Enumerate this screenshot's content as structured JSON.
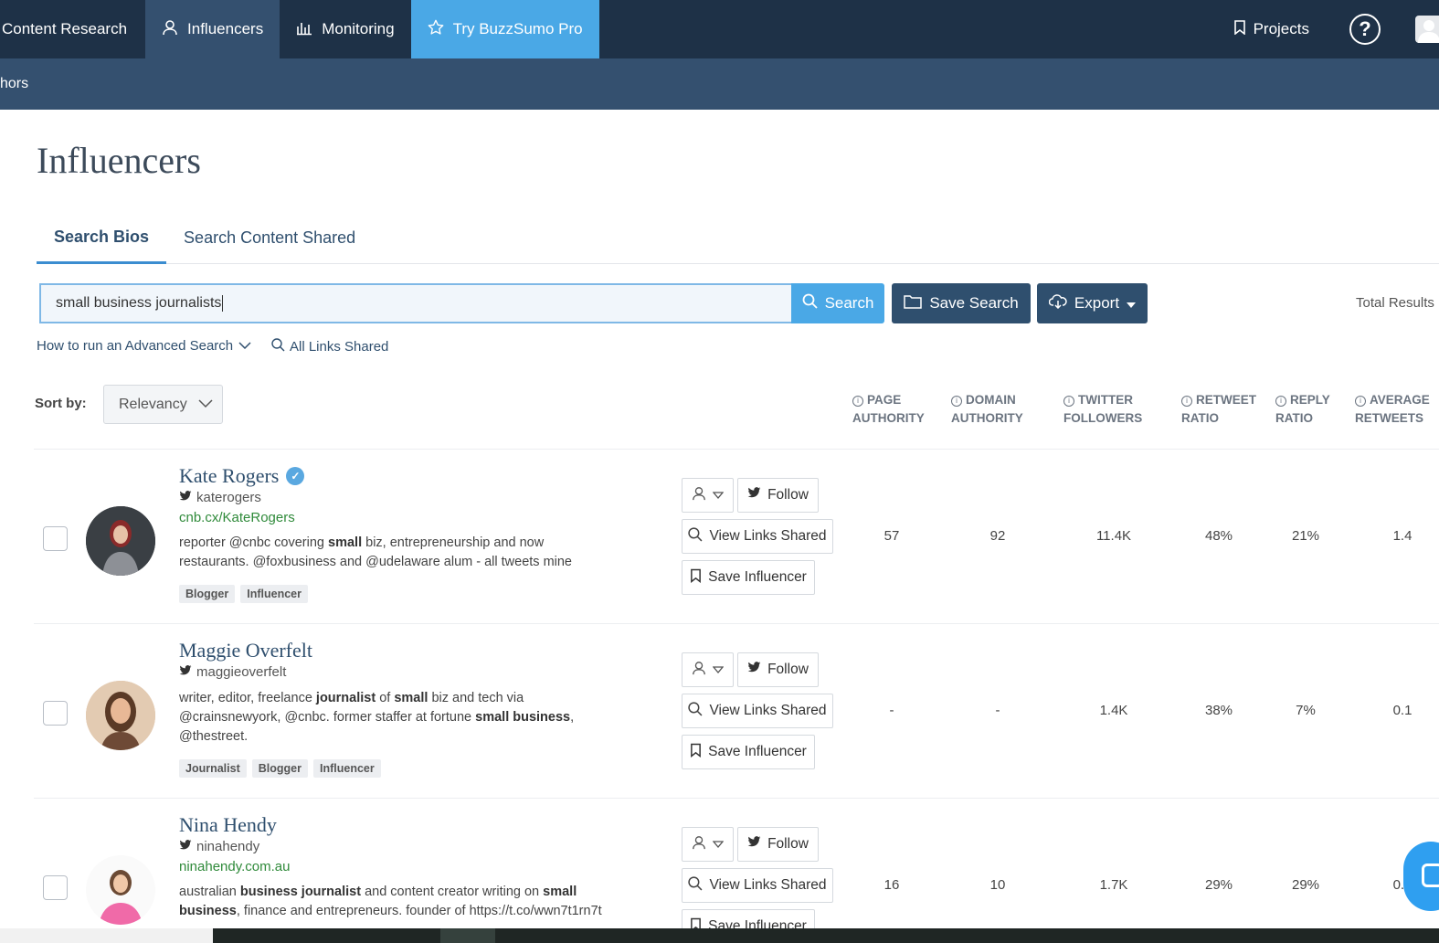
{
  "topnav": {
    "items": [
      {
        "label": "Content Research",
        "icon": "none"
      },
      {
        "label": "Influencers",
        "icon": "user-icon"
      },
      {
        "label": "Monitoring",
        "icon": "bar-chart-icon"
      },
      {
        "label": "Try BuzzSumo Pro",
        "icon": "star-icon"
      }
    ],
    "projects_label": "Projects",
    "help_label": "?"
  },
  "subnav": {
    "label": "hors"
  },
  "page": {
    "title": "Influencers"
  },
  "tabs": [
    {
      "label": "Search Bios",
      "active": true
    },
    {
      "label": "Search Content Shared",
      "active": false
    }
  ],
  "search": {
    "value": "small business journalists",
    "button_label": "Search",
    "save_label": "Save Search",
    "export_label": "Export",
    "total_results_label": "Total Results"
  },
  "links": {
    "advanced": "How to run an Advanced Search",
    "all_links": "All Links Shared"
  },
  "sort": {
    "label": "Sort by:",
    "value": "Relevancy"
  },
  "columns": [
    {
      "line1": "PAGE",
      "line2": "AUTHORITY"
    },
    {
      "line1": "DOMAIN",
      "line2": "AUTHORITY"
    },
    {
      "line1": "TWITTER",
      "line2": "FOLLOWERS"
    },
    {
      "line1": "RETWEET",
      "line2": "RATIO"
    },
    {
      "line1": "REPLY",
      "line2": "RATIO"
    },
    {
      "line1": "AVERAGE",
      "line2": "RETWEETS"
    }
  ],
  "actions": {
    "follow": "Follow",
    "view_links": "View Links Shared",
    "save_influencer": "Save Influencer"
  },
  "influencers": [
    {
      "name": "Kate Rogers",
      "verified": true,
      "handle": "katerogers",
      "site": "cnb.cx/KateRogers",
      "bio": [
        {
          "t": "reporter @cnbc covering ",
          "b": false
        },
        {
          "t": "small",
          "b": true
        },
        {
          "t": " biz, entrepreneurship and now restaurants. @foxbusiness and @udelaware alum - all tweets mine",
          "b": false
        }
      ],
      "tags": [
        "Blogger",
        "Influencer"
      ],
      "metrics": [
        "57",
        "92",
        "11.4K",
        "48%",
        "21%",
        "1.4"
      ]
    },
    {
      "name": "Maggie Overfelt",
      "verified": false,
      "handle": "maggieoverfelt",
      "site": "",
      "bio": [
        {
          "t": "writer, editor, freelance ",
          "b": false
        },
        {
          "t": "journalist",
          "b": true
        },
        {
          "t": " of ",
          "b": false
        },
        {
          "t": "small",
          "b": true
        },
        {
          "t": " biz and tech via @crainsnewyork, @cnbc. former staffer at fortune ",
          "b": false
        },
        {
          "t": "small business",
          "b": true
        },
        {
          "t": ", @thestreet.",
          "b": false
        }
      ],
      "tags": [
        "Journalist",
        "Blogger",
        "Influencer"
      ],
      "metrics": [
        "-",
        "-",
        "1.4K",
        "38%",
        "7%",
        "0.1"
      ]
    },
    {
      "name": "Nina Hendy",
      "verified": false,
      "handle": "ninahendy",
      "site": "ninahendy.com.au",
      "bio": [
        {
          "t": "australian ",
          "b": false
        },
        {
          "t": "business journalist",
          "b": true
        },
        {
          "t": " and content creator writing on ",
          "b": false
        },
        {
          "t": "small business",
          "b": true
        },
        {
          "t": ", finance and entrepreneurs. founder of https://t.co/wwn7t1rn7t",
          "b": false
        }
      ],
      "tags": [],
      "metrics": [
        "16",
        "10",
        "1.7K",
        "29%",
        "29%",
        "0.1"
      ]
    }
  ]
}
